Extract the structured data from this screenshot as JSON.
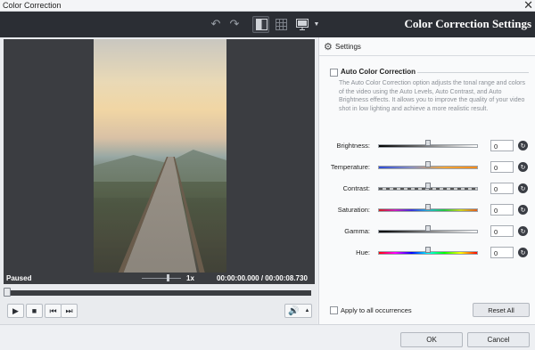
{
  "window": {
    "title": "Color Correction",
    "close_glyph": "✕"
  },
  "toolbar": {
    "heading": "Color Correction Settings",
    "icons": {
      "undo": "undo-icon",
      "redo": "redo-icon",
      "split_view": "split-view-icon",
      "grid": "grid-icon",
      "monitor": "monitor-icon"
    }
  },
  "player": {
    "state": "Paused",
    "speed": "1x",
    "time_current": "00:00:00.000",
    "time_separator": "/",
    "time_total": "00:00:08.730",
    "progress": 0
  },
  "settings": {
    "header_label": "Settings",
    "auto_correction": {
      "label": "Auto Color Correction",
      "checked": false,
      "description": "The Auto Color Correction option adjusts the tonal range and colors of the video using the Auto Levels, Auto Contrast, and Auto Brightness effects. It allows you to improve the quality of your video shot in low lighting and achieve a more realistic result."
    },
    "sliders": [
      {
        "label": "Brightness:",
        "value": "0"
      },
      {
        "label": "Temperature:",
        "value": "0"
      },
      {
        "label": "Contrast:",
        "value": "0"
      },
      {
        "label": "Saturation:",
        "value": "0"
      },
      {
        "label": "Gamma:",
        "value": "0"
      },
      {
        "label": "Hue:",
        "value": "0"
      }
    ],
    "apply_all_label": "Apply to all occurrences",
    "reset_all_label": "Reset All"
  },
  "footer": {
    "ok_label": "OK",
    "cancel_label": "Cancel"
  }
}
